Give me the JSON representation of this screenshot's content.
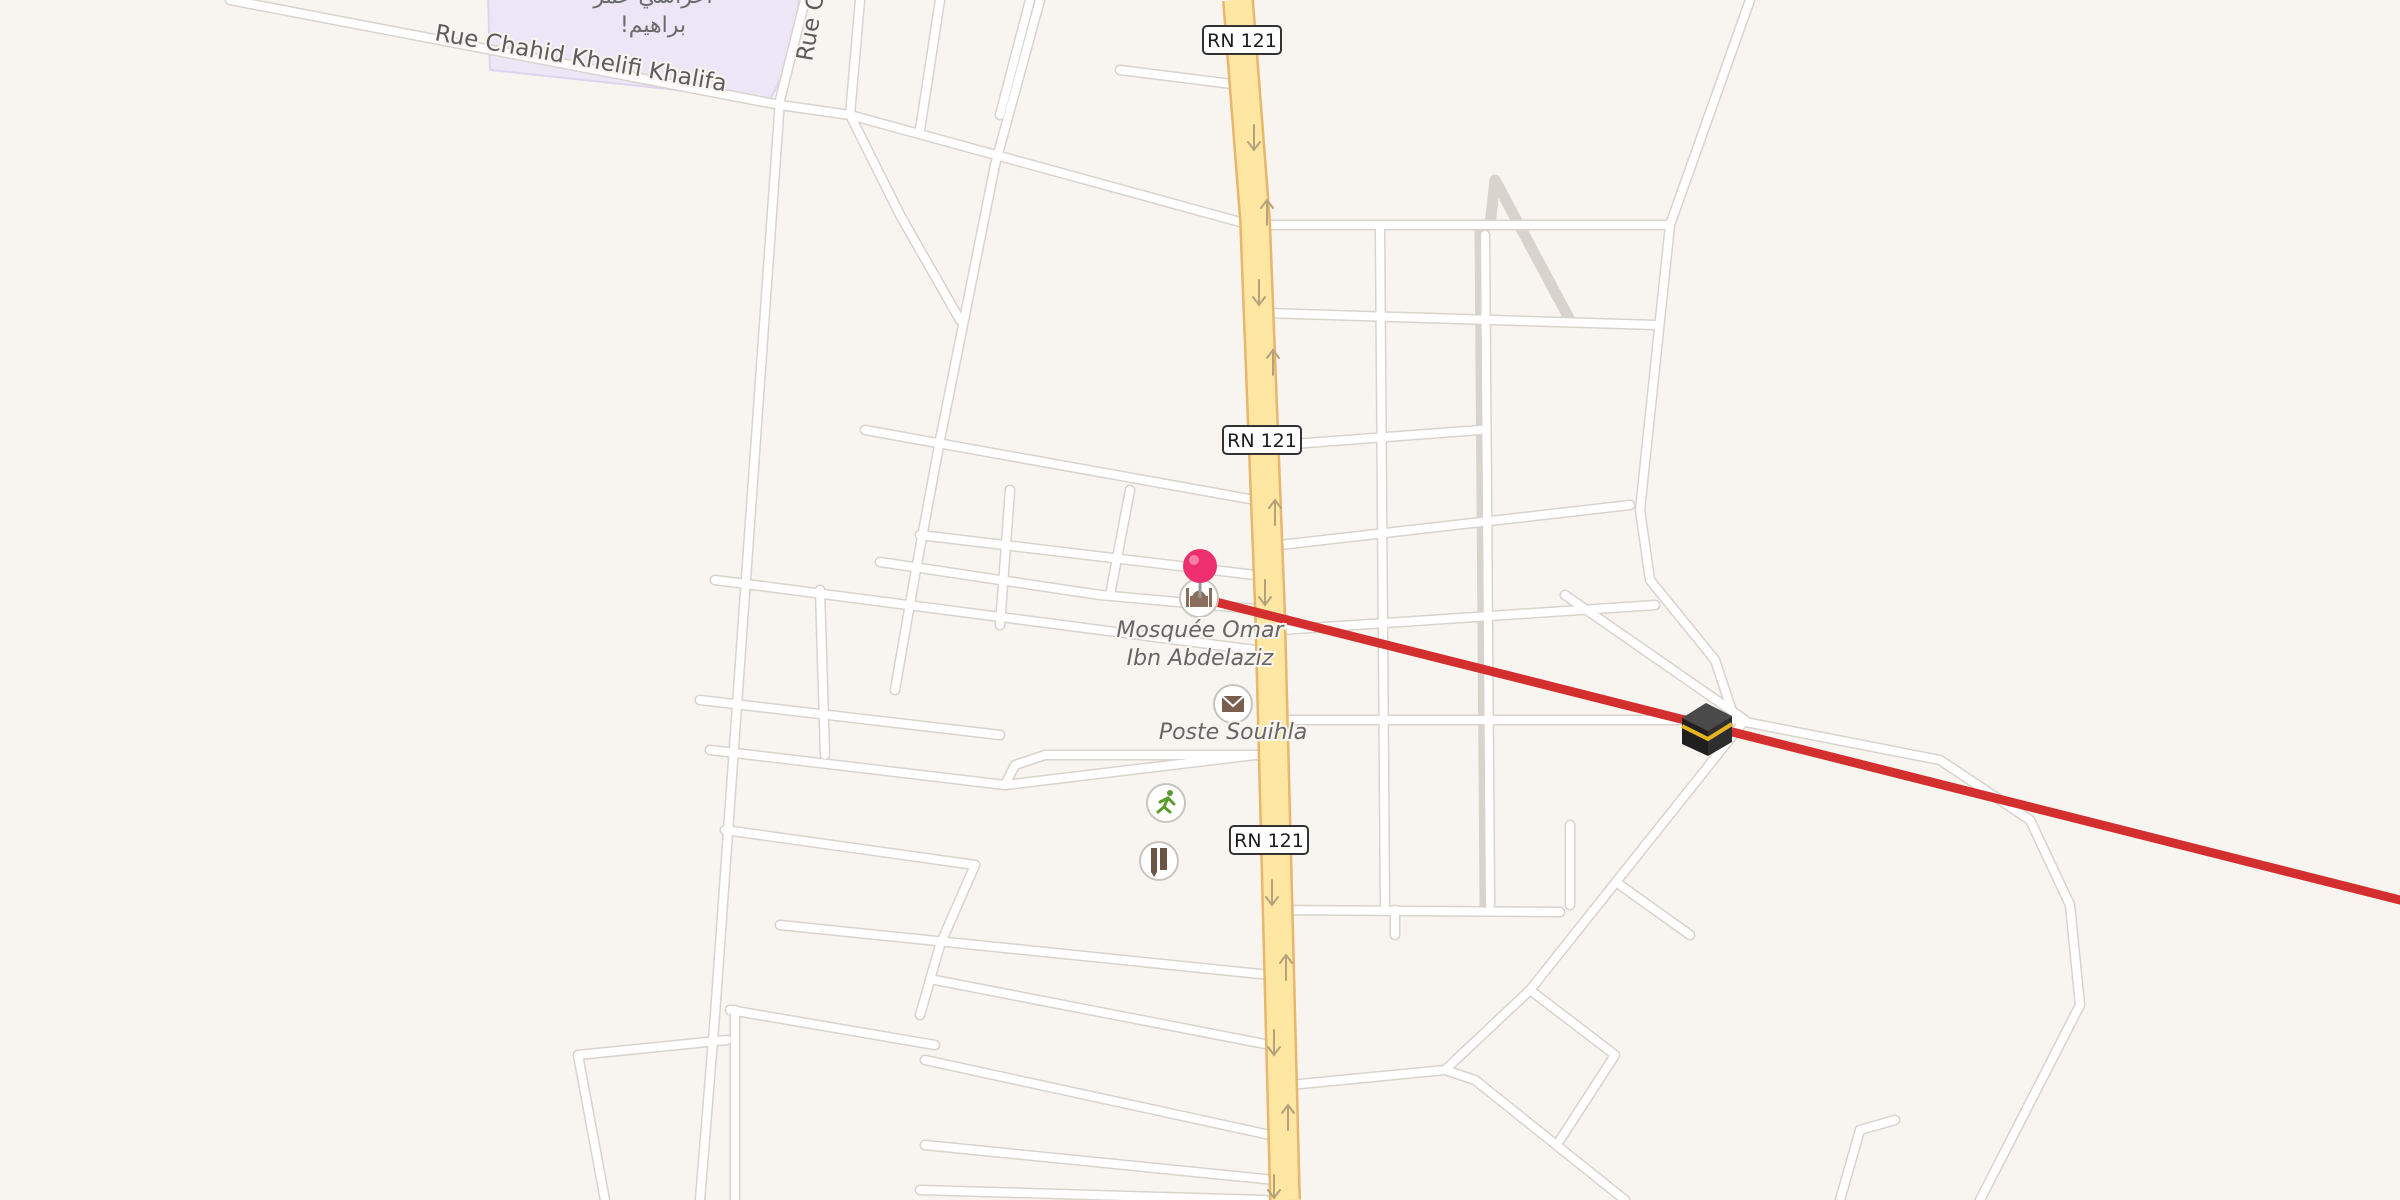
{
  "map": {
    "colors": {
      "background": "#f8f5f1",
      "road": "#ffffff",
      "primary_road": "#fde7a3",
      "primary_road_casing": "#e9b66c",
      "route": "#d42f2f",
      "pin": "#ee2f6f",
      "area": "#ece6f7"
    },
    "streets": {
      "rue_chahid": "Rue Chahid Khelifi Khalifa",
      "rue_c": "Rue C"
    },
    "shields": [
      "RN 121",
      "RN 121",
      "RN 121"
    ],
    "area_label": {
      "line1": "اعراسي عمر",
      "line2": "!براهيم"
    },
    "pois": {
      "mosque": {
        "label_line1": "Mosquée Omar",
        "label_line2": "Ibn Abdelaziz",
        "icon": "mosque-icon"
      },
      "post": {
        "label": "Poste Souihla",
        "icon": "envelope-icon"
      },
      "sport": {
        "icon": "running-person-icon"
      },
      "school": {
        "icon": "ruler-pencil-icon"
      },
      "kaaba": {
        "icon": "kaaba-icon"
      },
      "pin": {
        "icon": "map-pin-icon"
      }
    }
  }
}
